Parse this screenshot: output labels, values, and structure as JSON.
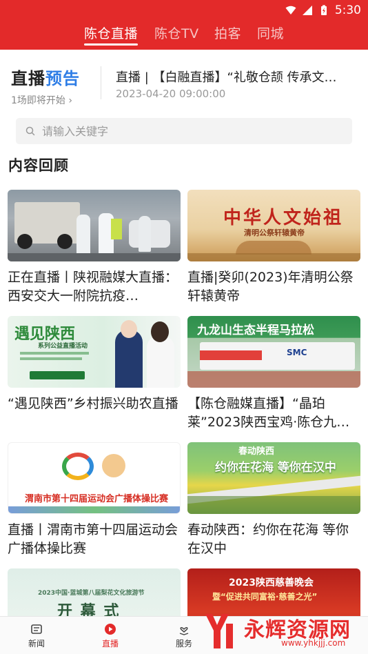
{
  "status_bar": {
    "time": "5:30"
  },
  "top_tabs": [
    {
      "label": "陈仓直播",
      "active": true
    },
    {
      "label": "陈仓TV",
      "active": false
    },
    {
      "label": "拍客",
      "active": false
    },
    {
      "label": "同城",
      "active": false
    }
  ],
  "live_preview": {
    "title_main": "直播",
    "title_accent": "预告",
    "subtitle": "1场即将开始",
    "chevron": "›",
    "headline": "直播 | 【白融直播】“礼敬仓颉 传承文…",
    "time": "2023-04-20 09:00:00"
  },
  "search": {
    "placeholder": "请输入关键字",
    "value": ""
  },
  "section_title": "内容回顾",
  "cards": [
    {
      "title": "正在直播丨陕视融媒大直播：西安交大一附院抗疫…",
      "thumb_text": ""
    },
    {
      "title": "直播|癸卯(2023)年清明公祭轩辕黄帝",
      "thumb_text": "中华人文始祖",
      "thumb_sub": "清明公祭轩辕黄帝"
    },
    {
      "title": "“遇见陕西”乡村振兴助农直播",
      "thumb_text": "遇见陕西",
      "thumb_sub": "系列公益直播活动"
    },
    {
      "title": "【陈仓融媒直播】“晶珀莱”2023陕西宝鸡·陈仓九…",
      "thumb_text": "九龙山生态半程马拉松",
      "thumb_sub": "SMC"
    },
    {
      "title": "直播丨渭南市第十四届运动会广播体操比赛",
      "thumb_text": "渭南市第十四届运动会广播体操比赛"
    },
    {
      "title": "春动陕西：约你在花海 等你在汉中",
      "thumb_text": "约你在花海 等你在汉中",
      "thumb_sub": "春动陕西"
    },
    {
      "title": "",
      "thumb_text": "开 幕 式",
      "thumb_sub": "2023中国·蓝城第八届梨花文化旅游节"
    },
    {
      "title": "",
      "thumb_text": "2023陕西慈善晚会",
      "thumb_sub": "暨“促进共同富裕·慈善之光”"
    }
  ],
  "bottom_nav": [
    {
      "label": "新闻",
      "icon": "news-icon",
      "active": false
    },
    {
      "label": "直播",
      "icon": "play-icon",
      "active": true
    },
    {
      "label": "服务",
      "icon": "heart-hand-icon",
      "active": false
    }
  ],
  "watermark": {
    "text": "永辉资源网",
    "url": "www.yhkjjj.com"
  },
  "colors": {
    "brand_red": "#e32a2a",
    "accent_blue": "#2f7ee6"
  }
}
